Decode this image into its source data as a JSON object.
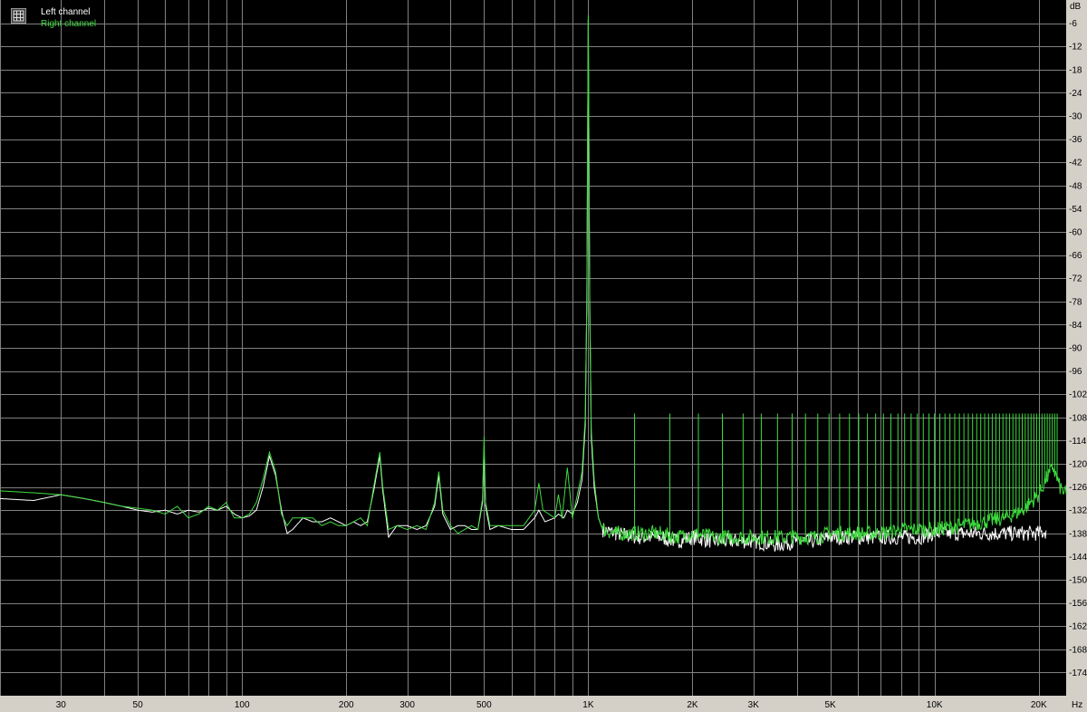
{
  "chart_data": {
    "type": "line",
    "title": "",
    "xlabel": "",
    "ylabel": "",
    "x_unit": "Hz",
    "y_unit": "dB",
    "x_scale": "log",
    "xlim": [
      20,
      24000
    ],
    "ylim": [
      -180,
      0
    ],
    "grid": true,
    "legend": "top-left",
    "background": "#000000",
    "grid_color": "#808080",
    "x_ticks": [
      {
        "value": 30,
        "label": "30"
      },
      {
        "value": 50,
        "label": "50"
      },
      {
        "value": 100,
        "label": "100"
      },
      {
        "value": 200,
        "label": "200"
      },
      {
        "value": 300,
        "label": "300"
      },
      {
        "value": 500,
        "label": "500"
      },
      {
        "value": 1000,
        "label": "1K"
      },
      {
        "value": 2000,
        "label": "2K"
      },
      {
        "value": 3000,
        "label": "3K"
      },
      {
        "value": 5000,
        "label": "5K"
      },
      {
        "value": 10000,
        "label": "10K"
      },
      {
        "value": 20000,
        "label": "20K"
      }
    ],
    "x_grid": [
      20,
      30,
      40,
      50,
      60,
      70,
      80,
      90,
      100,
      200,
      300,
      400,
      500,
      600,
      700,
      800,
      900,
      1000,
      2000,
      3000,
      4000,
      5000,
      6000,
      7000,
      8000,
      9000,
      10000,
      20000
    ],
    "y_ticks": [
      -6,
      -12,
      -18,
      -24,
      -30,
      -36,
      -42,
      -48,
      -54,
      -60,
      -66,
      -72,
      -78,
      -84,
      -90,
      -96,
      -102,
      -108,
      -114,
      -120,
      -126,
      -132,
      -138,
      -144,
      -150,
      -156,
      -162,
      -168,
      -174
    ],
    "series": [
      {
        "name": "Left channel",
        "color": "#ffffff",
        "points": [
          [
            20,
            -129
          ],
          [
            25,
            -129.5
          ],
          [
            30,
            -128
          ],
          [
            35,
            -129
          ],
          [
            40,
            -130
          ],
          [
            45,
            -131
          ],
          [
            50,
            -132
          ],
          [
            55,
            -132.5
          ],
          [
            60,
            -132
          ],
          [
            65,
            -133
          ],
          [
            70,
            -132
          ],
          [
            75,
            -132.5
          ],
          [
            80,
            -131.5
          ],
          [
            85,
            -132
          ],
          [
            90,
            -131
          ],
          [
            95,
            -133
          ],
          [
            100,
            -134
          ],
          [
            105,
            -133.5
          ],
          [
            110,
            -132
          ],
          [
            115,
            -126
          ],
          [
            120,
            -118
          ],
          [
            125,
            -123
          ],
          [
            130,
            -132
          ],
          [
            135,
            -138
          ],
          [
            140,
            -137
          ],
          [
            150,
            -134
          ],
          [
            160,
            -135
          ],
          [
            170,
            -135
          ],
          [
            180,
            -134
          ],
          [
            190,
            -135
          ],
          [
            200,
            -136
          ],
          [
            210,
            -135
          ],
          [
            220,
            -136
          ],
          [
            230,
            -135
          ],
          [
            240,
            -127
          ],
          [
            250,
            -118
          ],
          [
            255,
            -127
          ],
          [
            265,
            -139
          ],
          [
            280,
            -136
          ],
          [
            300,
            -136
          ],
          [
            320,
            -137
          ],
          [
            340,
            -136
          ],
          [
            360,
            -131
          ],
          [
            370,
            -123
          ],
          [
            380,
            -133
          ],
          [
            400,
            -137
          ],
          [
            420,
            -136
          ],
          [
            440,
            -136
          ],
          [
            460,
            -137
          ],
          [
            480,
            -137
          ],
          [
            495,
            -130
          ],
          [
            500,
            -116
          ],
          [
            505,
            -131
          ],
          [
            520,
            -137
          ],
          [
            550,
            -136
          ],
          [
            600,
            -137
          ],
          [
            650,
            -137
          ],
          [
            700,
            -134
          ],
          [
            720,
            -132
          ],
          [
            750,
            -135
          ],
          [
            800,
            -134
          ],
          [
            820,
            -133
          ],
          [
            850,
            -134
          ],
          [
            870,
            -132
          ],
          [
            900,
            -133
          ],
          [
            930,
            -130
          ],
          [
            960,
            -124
          ],
          [
            980,
            -110
          ],
          [
            990,
            -80
          ],
          [
            1000,
            -5
          ],
          [
            1010,
            -80
          ],
          [
            1020,
            -113
          ],
          [
            1040,
            -126
          ],
          [
            1070,
            -134
          ],
          [
            1100,
            -137
          ],
          [
            1200,
            -138
          ],
          [
            1400,
            -139
          ],
          [
            1600,
            -139
          ],
          [
            1800,
            -140
          ],
          [
            2000,
            -139
          ],
          [
            2300,
            -140
          ],
          [
            2600,
            -140
          ],
          [
            3000,
            -140
          ],
          [
            3500,
            -141
          ],
          [
            4000,
            -140
          ],
          [
            4500,
            -140
          ],
          [
            5000,
            -139
          ],
          [
            6000,
            -139
          ],
          [
            7000,
            -139
          ],
          [
            8000,
            -139
          ],
          [
            9000,
            -139
          ],
          [
            10000,
            -138
          ],
          [
            12000,
            -138
          ],
          [
            14000,
            -138
          ],
          [
            16000,
            -138
          ],
          [
            18000,
            -138
          ],
          [
            20000,
            -138
          ],
          [
            21000,
            -137.5
          ]
        ]
      },
      {
        "name": "Right channel",
        "color": "#3ddc3d",
        "points": [
          [
            20,
            -127
          ],
          [
            25,
            -127.5
          ],
          [
            30,
            -128
          ],
          [
            35,
            -129
          ],
          [
            40,
            -130
          ],
          [
            45,
            -131
          ],
          [
            50,
            -131.5
          ],
          [
            55,
            -132
          ],
          [
            60,
            -133
          ],
          [
            65,
            -131
          ],
          [
            70,
            -134
          ],
          [
            75,
            -133
          ],
          [
            80,
            -131
          ],
          [
            85,
            -132
          ],
          [
            90,
            -130
          ],
          [
            95,
            -134
          ],
          [
            100,
            -134
          ],
          [
            105,
            -133
          ],
          [
            110,
            -130
          ],
          [
            115,
            -124
          ],
          [
            120,
            -117
          ],
          [
            125,
            -122
          ],
          [
            130,
            -133
          ],
          [
            135,
            -136
          ],
          [
            140,
            -134
          ],
          [
            150,
            -134
          ],
          [
            160,
            -134
          ],
          [
            170,
            -136
          ],
          [
            180,
            -135
          ],
          [
            190,
            -136
          ],
          [
            200,
            -136
          ],
          [
            210,
            -135
          ],
          [
            220,
            -134
          ],
          [
            230,
            -136
          ],
          [
            240,
            -126
          ],
          [
            250,
            -117
          ],
          [
            255,
            -126
          ],
          [
            265,
            -137
          ],
          [
            280,
            -136
          ],
          [
            300,
            -137
          ],
          [
            320,
            -136
          ],
          [
            340,
            -137
          ],
          [
            360,
            -130
          ],
          [
            370,
            -122
          ],
          [
            380,
            -132
          ],
          [
            400,
            -136
          ],
          [
            420,
            -138
          ],
          [
            440,
            -137
          ],
          [
            460,
            -136
          ],
          [
            480,
            -137
          ],
          [
            495,
            -129
          ],
          [
            500,
            -113
          ],
          [
            505,
            -130
          ],
          [
            520,
            -136
          ],
          [
            550,
            -136
          ],
          [
            600,
            -136
          ],
          [
            650,
            -136
          ],
          [
            700,
            -132
          ],
          [
            720,
            -125
          ],
          [
            740,
            -132
          ],
          [
            800,
            -134
          ],
          [
            820,
            -128
          ],
          [
            840,
            -134
          ],
          [
            870,
            -121
          ],
          [
            900,
            -134
          ],
          [
            930,
            -128
          ],
          [
            960,
            -122
          ],
          [
            980,
            -108
          ],
          [
            990,
            -78
          ],
          [
            1000,
            -4
          ],
          [
            1010,
            -78
          ],
          [
            1020,
            -111
          ],
          [
            1040,
            -124
          ],
          [
            1070,
            -134
          ],
          [
            1100,
            -137
          ],
          [
            1200,
            -138
          ],
          [
            1400,
            -138
          ],
          [
            1600,
            -138
          ],
          [
            1800,
            -139
          ],
          [
            2000,
            -138
          ],
          [
            2300,
            -139
          ],
          [
            2600,
            -139
          ],
          [
            3000,
            -139
          ],
          [
            3500,
            -139
          ],
          [
            4000,
            -139
          ],
          [
            4500,
            -139
          ],
          [
            5000,
            -138
          ],
          [
            6000,
            -138
          ],
          [
            7000,
            -138
          ],
          [
            8000,
            -137
          ],
          [
            9000,
            -137
          ],
          [
            10000,
            -137
          ],
          [
            12000,
            -136
          ],
          [
            14000,
            -135
          ],
          [
            16000,
            -134
          ],
          [
            18000,
            -132
          ],
          [
            20000,
            -128
          ],
          [
            21000,
            -124
          ],
          [
            22000,
            -121
          ],
          [
            23000,
            -126
          ],
          [
            24000,
            -128
          ]
        ]
      }
    ],
    "harmonic_spur_count": 60,
    "harmonic_spur_start_hz": 1000,
    "harmonic_spur_step_hz": 1000
  },
  "legend": {
    "items": [
      {
        "label": "Left channel",
        "color": "#ffffff"
      },
      {
        "label": "Right channel",
        "color": "#3ddc3d"
      }
    ]
  }
}
